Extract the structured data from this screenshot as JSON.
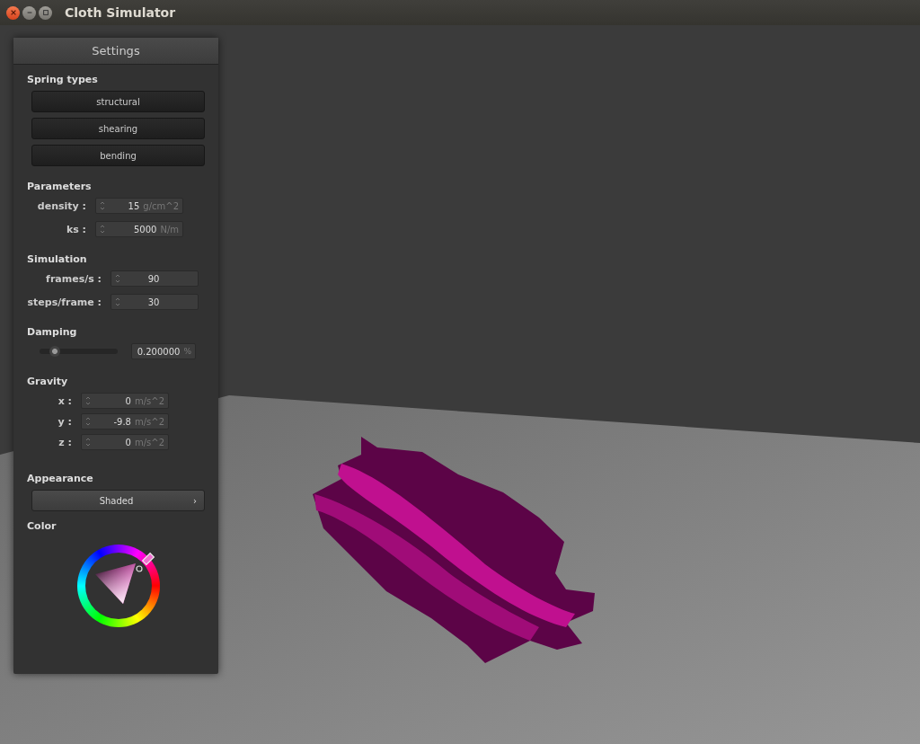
{
  "window": {
    "title": "Cloth Simulator"
  },
  "panel": {
    "title": "Settings",
    "spring_types": {
      "heading": "Spring types",
      "buttons": [
        "structural",
        "shearing",
        "bending"
      ]
    },
    "parameters": {
      "heading": "Parameters",
      "fields": [
        {
          "label": "density :",
          "value": "15",
          "unit": "g/cm^2"
        },
        {
          "label": "ks :",
          "value": "5000",
          "unit": "N/m"
        }
      ]
    },
    "simulation": {
      "heading": "Simulation",
      "fields": [
        {
          "label": "frames/s :",
          "value": "90"
        },
        {
          "label": "steps/frame :",
          "value": "30"
        }
      ]
    },
    "damping": {
      "heading": "Damping",
      "level": 0.2,
      "value": "0.200000",
      "unit": "%"
    },
    "gravity": {
      "heading": "Gravity",
      "fields": [
        {
          "label": "x :",
          "value": "0",
          "unit": "m/s^2"
        },
        {
          "label": "y :",
          "value": "-9.8",
          "unit": "m/s^2"
        },
        {
          "label": "z :",
          "value": "0",
          "unit": "m/s^2"
        }
      ]
    },
    "appearance": {
      "heading": "Appearance",
      "value": "Shaded",
      "arrow": "›"
    },
    "color": {
      "heading": "Color"
    }
  }
}
